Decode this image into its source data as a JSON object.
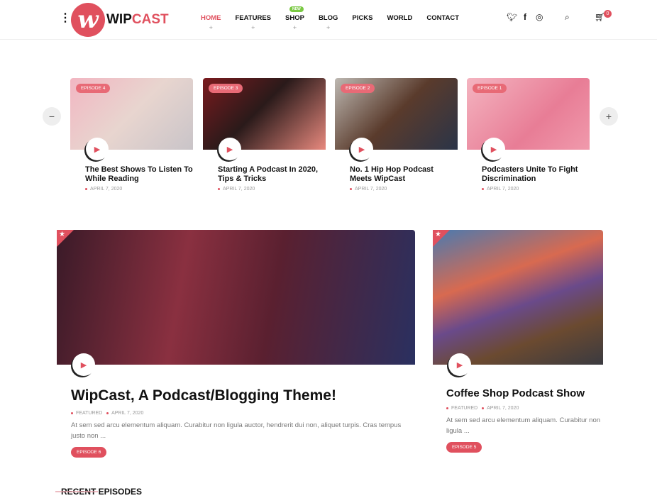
{
  "header": {
    "logo_letter": "w",
    "logo_text_dark": "WIP",
    "logo_text_accent": "CAST",
    "nav": [
      {
        "label": "HOME",
        "active": true,
        "plus": "+"
      },
      {
        "label": "FEATURES",
        "plus": "+"
      },
      {
        "label": "SHOP",
        "plus": "+",
        "badge": "NEW"
      },
      {
        "label": "BLOG",
        "plus": "+"
      },
      {
        "label": "PICKS"
      },
      {
        "label": "WORLD"
      },
      {
        "label": "CONTACT"
      }
    ],
    "cart_count": "0"
  },
  "carousel": {
    "prev": "−",
    "next": "+",
    "items": [
      {
        "tag": "EPISODE 4",
        "title": "The Best Shows To Listen To While Reading",
        "date": "APRIL 7, 2020"
      },
      {
        "tag": "EPISODE 3",
        "title": "Starting A Podcast In 2020, Tips & Tricks",
        "date": "APRIL 7, 2020"
      },
      {
        "tag": "EPISODE 2",
        "title": "No. 1 Hip Hop Podcast Meets WipCast",
        "date": "APRIL 7, 2020"
      },
      {
        "tag": "EPISODE 1",
        "title": "Podcasters Unite To Fight Discrimination",
        "date": "APRIL 7, 2020"
      }
    ]
  },
  "featured": [
    {
      "title": "WipCast, A Podcast/Blogging Theme!",
      "category": "FEATURED",
      "date": "APRIL 7, 2020",
      "excerpt": "At sem sed arcu elementum aliquam. Curabitur non ligula auctor, hendrerit dui non, aliquet turpis. Cras tempus justo non ...",
      "button": "EPISODE 6"
    },
    {
      "title": "Coffee Shop Podcast Show",
      "category": "FEATURED",
      "date": "APRIL 7, 2020",
      "excerpt": "At sem sed arcu elementum aliquam. Curabitur non ligula ...",
      "button": "EPISODE 5"
    }
  ],
  "section_title": "RECENT EPISODES",
  "colors": {
    "accent": "#e0505e",
    "new_badge": "#7ac943"
  }
}
